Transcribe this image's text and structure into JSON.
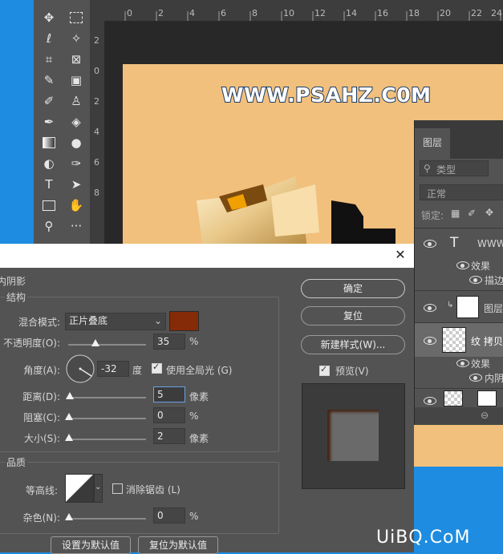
{
  "ruler": {
    "top_labels": [
      "0",
      "2",
      "4",
      "6",
      "8",
      "10",
      "12",
      "14",
      "16",
      "18",
      "20",
      "22",
      "24"
    ],
    "left_labels": [
      "2",
      "0",
      "2",
      "4",
      "6",
      "8"
    ]
  },
  "canvas": {
    "watermark_text": "WWW.PSAHZ.C0M",
    "background_color": "#f1c07c"
  },
  "layers": {
    "tab_label": "图层",
    "filter_label": "类型",
    "blend_mode": "正常",
    "lock_label": "锁定:",
    "items": [
      {
        "type_glyph": "T",
        "name": "WWW."
      },
      {
        "sub": "效果"
      },
      {
        "sub2": "描边"
      },
      {
        "name": "图层"
      },
      {
        "name": "纹 拷贝"
      },
      {
        "sub": "效果"
      },
      {
        "sub2": "内阴"
      }
    ]
  },
  "dialog": {
    "section_title": "内阴影",
    "structure_title": "结构",
    "blend_mode_label": "混合模式:",
    "blend_mode_value": "正片叠底",
    "shadow_color": "#852b07",
    "opacity_label": "不透明度(O):",
    "opacity_value": "35",
    "opacity_unit": "%",
    "angle_label": "角度(A):",
    "angle_value": "-32",
    "angle_unit": "度",
    "global_light_label": "使用全局光 (G)",
    "distance_label": "距离(D):",
    "distance_value": "5",
    "distance_unit": "像素",
    "choke_label": "阻塞(C):",
    "choke_value": "0",
    "choke_unit": "%",
    "size_label": "大小(S):",
    "size_value": "2",
    "size_unit": "像素",
    "quality_title": "品质",
    "contour_label": "等高线:",
    "antialias_label": "消除锯齿 (L)",
    "noise_label": "杂色(N):",
    "noise_value": "0",
    "noise_unit": "%",
    "set_default_label": "设置为默认值",
    "reset_default_label": "复位为默认值",
    "ok_label": "确定",
    "reset_label": "复位",
    "new_style_label": "新建样式(W)...",
    "preview_label": "预览(V)",
    "opacity_fraction": 0.35,
    "distance_fraction": 0.02,
    "size_fraction": 0.01
  },
  "brand": {
    "text": "UiBQ.CoM"
  }
}
